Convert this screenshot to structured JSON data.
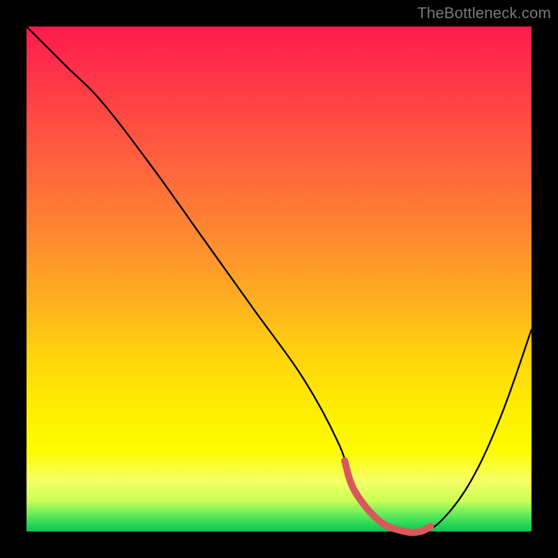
{
  "watermark": "TheBottleneck.com",
  "colors": {
    "background": "#000000",
    "watermark": "#7a7a7a",
    "curve": "#000000",
    "highlight": "#d9585c",
    "gradient_top": "#ff1a4d",
    "gradient_bottom": "#00c853"
  },
  "chart_data": {
    "type": "line",
    "title": "",
    "xlabel": "",
    "ylabel": "",
    "xlim": [
      0,
      100
    ],
    "ylim": [
      0,
      100
    ],
    "x": [
      0,
      3,
      8,
      15,
      25,
      35,
      45,
      55,
      62,
      65,
      70,
      75,
      78,
      82,
      88,
      94,
      100
    ],
    "y": [
      100,
      97,
      92,
      85,
      72,
      58,
      44,
      30,
      17,
      8,
      2,
      0,
      0,
      2,
      10,
      23,
      40
    ],
    "highlight_range_x": [
      63,
      80
    ],
    "note": "y is plotted with 0 at the bottom of the plot area and 100 at the top; x runs left→right. Values are visual estimates read off the figure. The curve is a V-shaped bottleneck profile with its minimum (≈0) between x≈70 and x≈78; the highlight_range_x segment is drawn as a thick reddish stroke along the bottom of the valley."
  }
}
